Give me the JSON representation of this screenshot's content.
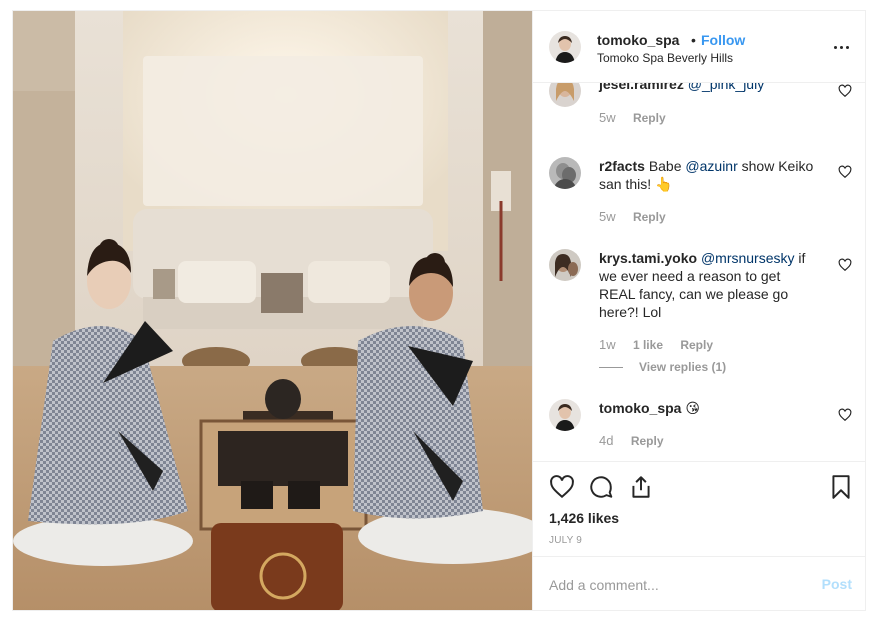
{
  "post": {
    "username": "tomoko_spa",
    "separator": "•",
    "follow_label": "Follow",
    "location": "Tomoko Spa Beverly Hills",
    "more_icon": "more-options-icon",
    "photo_description_icon": "post-photo"
  },
  "comments": [
    {
      "username": "jesei.ramirez",
      "mention": "@_pink_july",
      "text": "",
      "time": "5w",
      "likes": "",
      "reply_label": "Reply"
    },
    {
      "username": "r2facts",
      "text_before": "Babe",
      "mention": "@azuinr",
      "text": "show Keiko san this! 👆",
      "time": "5w",
      "likes": "",
      "reply_label": "Reply"
    },
    {
      "username": "krys.tami.yoko",
      "mention": "@mrsnursesky",
      "text": "if we ever need a reason to get REAL fancy, can we please go here?! Lol",
      "time": "1w",
      "likes": "1 like",
      "reply_label": "Reply",
      "view_replies": "View replies (1)"
    },
    {
      "username": "tomoko_spa",
      "text": "😘",
      "time": "4d",
      "likes": "",
      "reply_label": "Reply"
    }
  ],
  "actions": {
    "like_icon": "heart-icon",
    "comment_icon": "comment-icon",
    "share_icon": "share-icon",
    "save_icon": "bookmark-icon",
    "likes_count": "1,426 likes",
    "date": "JULY 9"
  },
  "add_comment": {
    "placeholder": "Add a comment...",
    "post_label": "Post"
  },
  "colors": {
    "accent": "#3897f0",
    "text": "#262626",
    "muted": "#999999",
    "border": "#efefef",
    "post_disabled": "#b2dffc"
  }
}
